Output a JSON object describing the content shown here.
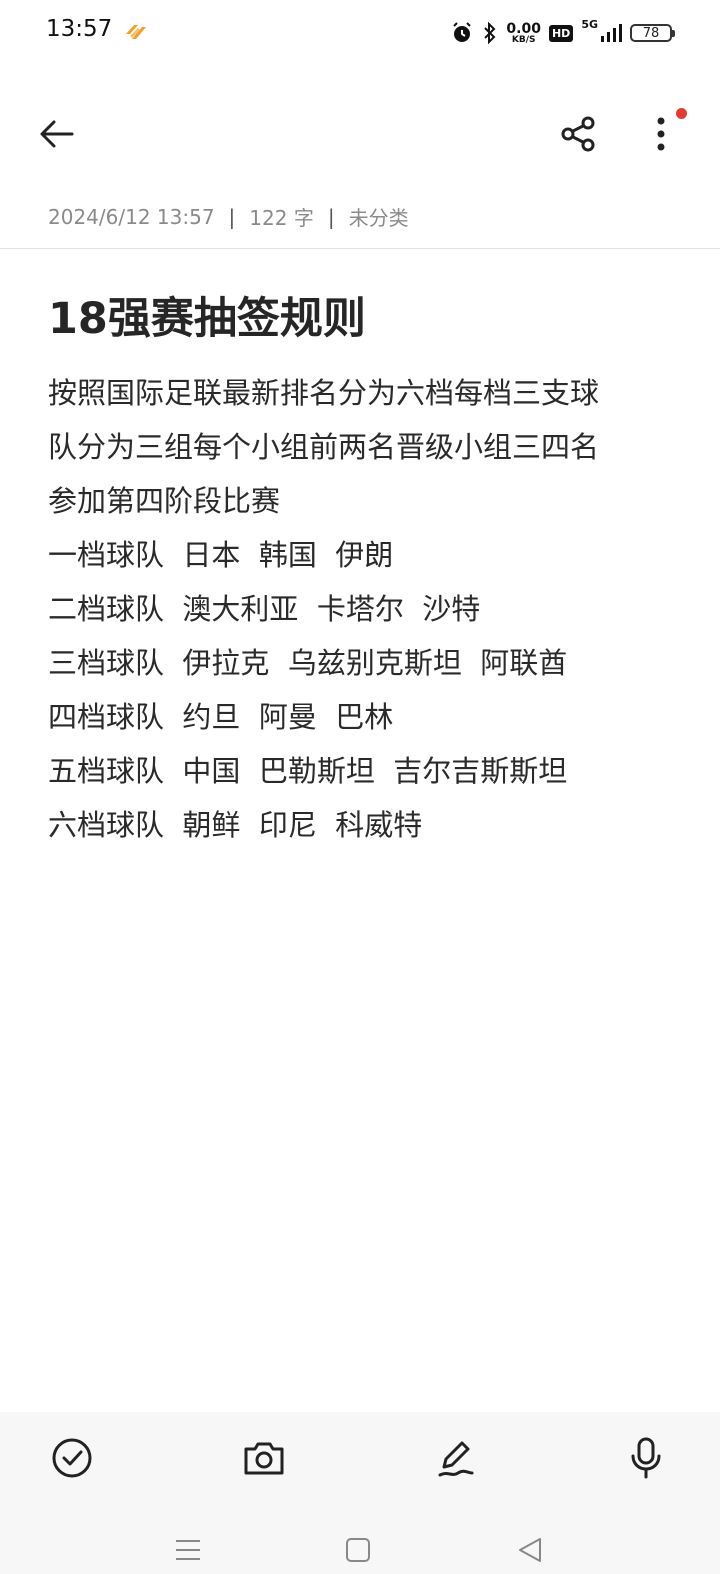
{
  "status_bar": {
    "time": "13:57",
    "speed_value": "0.00",
    "speed_unit": "KB/S",
    "hd": "HD",
    "network": "5G",
    "battery": "78"
  },
  "note": {
    "date": "2024/6/12 13:57",
    "word_count": "122 字",
    "category": "未分类",
    "title": "18强赛抽签规则",
    "lines": [
      "按照国际足联最新排名分为六档每档三支球",
      "队分为三组每个小组前两名晋级小组三四名",
      "参加第四阶段比赛",
      "一档球队  日本  韩国  伊朗",
      "二档球队  澳大利亚  卡塔尔  沙特",
      "三档球队  伊拉克  乌兹别克斯坦  阿联酋",
      "四档球队  约旦  阿曼  巴林",
      "五档球队  中国  巴勒斯坦  吉尔吉斯斯坦",
      "六档球队  朝鲜  印尼  科威特"
    ]
  },
  "icons": {
    "back": "arrow-left-icon",
    "share": "share-icon",
    "more": "more-vertical-icon",
    "checklist": "check-circle-icon",
    "camera": "camera-icon",
    "handwriting": "pen-icon",
    "voice": "microphone-icon"
  },
  "colors": {
    "notification_dot": "#e33d33",
    "bottom_bar_bg": "#f7f7f7",
    "meta_text": "#8a8a8a"
  }
}
